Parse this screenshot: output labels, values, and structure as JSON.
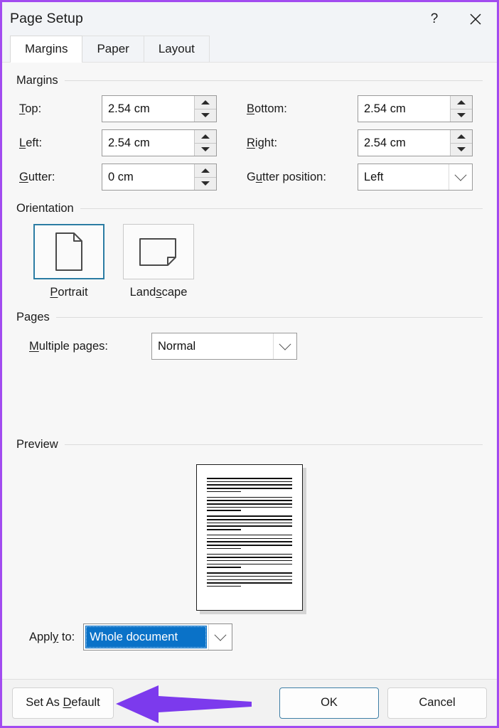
{
  "window": {
    "title": "Page Setup",
    "accent_border": "#a24bf0",
    "titlebar_buttons": [
      {
        "name": "help-icon",
        "glyph": "?"
      },
      {
        "name": "close-icon",
        "glyph": "✕"
      }
    ]
  },
  "tabs": [
    {
      "label": "Margins",
      "active": true
    },
    {
      "label": "Paper",
      "active": false
    },
    {
      "label": "Layout",
      "active": false
    }
  ],
  "margins": {
    "group_label": "Margins",
    "top": {
      "label": "Top:",
      "accel": "T",
      "value": "2.54 cm"
    },
    "bottom": {
      "label": "Bottom:",
      "accel": "B",
      "value": "2.54 cm"
    },
    "left": {
      "label": "Left:",
      "accel": "L",
      "value": "2.54 cm"
    },
    "right": {
      "label": "Right:",
      "accel": "R",
      "value": "2.54 cm"
    },
    "gutter": {
      "label": "Gutter:",
      "accel": "G",
      "value": "0 cm"
    },
    "gutter_position": {
      "label": "Gutter position:",
      "accel": "G",
      "value": "Left"
    }
  },
  "orientation": {
    "group_label": "Orientation",
    "options": [
      {
        "label": "Portrait",
        "accel": "P",
        "selected": true
      },
      {
        "label": "Landscape",
        "accel": "s",
        "selected": false
      }
    ]
  },
  "pages": {
    "group_label": "Pages",
    "multiple_pages": {
      "label": "Multiple pages:",
      "accel": "M",
      "value": "Normal"
    }
  },
  "preview": {
    "group_label": "Preview",
    "paragraph_blocks": 6,
    "lines_per_block": 4,
    "short_line_width_pct": 40
  },
  "apply_to": {
    "label": "Apply to:",
    "accel": "y",
    "value": "Whole document",
    "highlight_color": "#0a72c8"
  },
  "footer": {
    "set_as_default": {
      "label": "Set As Default",
      "accel": "D"
    },
    "ok": {
      "label": "OK",
      "is_default": true
    },
    "cancel": {
      "label": "Cancel"
    },
    "annotation_arrow": {
      "color": "#7c3aed",
      "direction": "left"
    }
  }
}
